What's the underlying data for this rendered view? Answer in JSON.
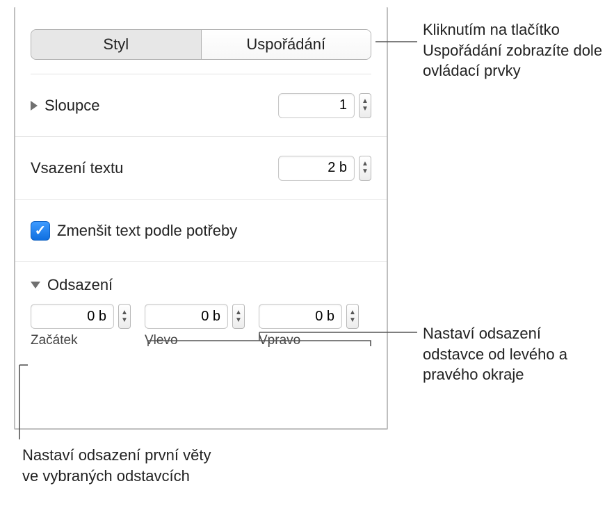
{
  "segmented": {
    "style": "Styl",
    "layout": "Uspořádání"
  },
  "columns": {
    "label": "Sloupce",
    "value": "1"
  },
  "textInset": {
    "label": "Vsazení textu",
    "value": "2 b"
  },
  "shrink": {
    "label": "Zmenšit text podle potřeby",
    "checked": true
  },
  "indent": {
    "title": "Odsazení",
    "first": {
      "label": "Začátek",
      "value": "0 b"
    },
    "left": {
      "label": "Vlevo",
      "value": "0 b"
    },
    "right": {
      "label": "Vpravo",
      "value": "0 b"
    }
  },
  "callouts": {
    "layout": "Kliknutím na tlačítko Uspořádání zobrazíte dole ovládací prvky",
    "lr": "Nastaví odsazení odstavce od levého a pravého okraje",
    "first": "Nastaví odsazení první věty ve vybraných odstavcích"
  }
}
